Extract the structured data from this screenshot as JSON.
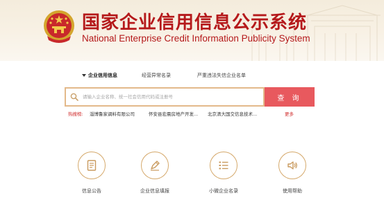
{
  "header": {
    "title_cn": "国家企业信用信息公示系统",
    "title_en": "National Enterprise Credit Information Publicity System"
  },
  "search": {
    "tabs": [
      {
        "label": "企业信用信息",
        "active": true
      },
      {
        "label": "经营异常名录",
        "active": false
      },
      {
        "label": "严重违法失信企业名单",
        "active": false
      }
    ],
    "placeholder": "请输入企业名称、统一社会信用代码或注册号",
    "button_label": "查 询"
  },
  "hot": {
    "label": "热搜榜:",
    "items": [
      "淄博鲁家调料有限公司",
      "怀安县宏晨房地产开发...",
      "北京清大国交信息技术..."
    ],
    "more_label": "更多"
  },
  "features": [
    {
      "label": "信息公告",
      "icon": "document-icon"
    },
    {
      "label": "企业信息填报",
      "icon": "pen-icon"
    },
    {
      "label": "小微企业名录",
      "icon": "list-icon"
    },
    {
      "label": "使用帮助",
      "icon": "speaker-icon"
    }
  ],
  "colors": {
    "brand_red": "#b5191b",
    "search_button": "#e8595e",
    "search_border": "#e3b98a",
    "icon_gold": "#d5a86a"
  }
}
